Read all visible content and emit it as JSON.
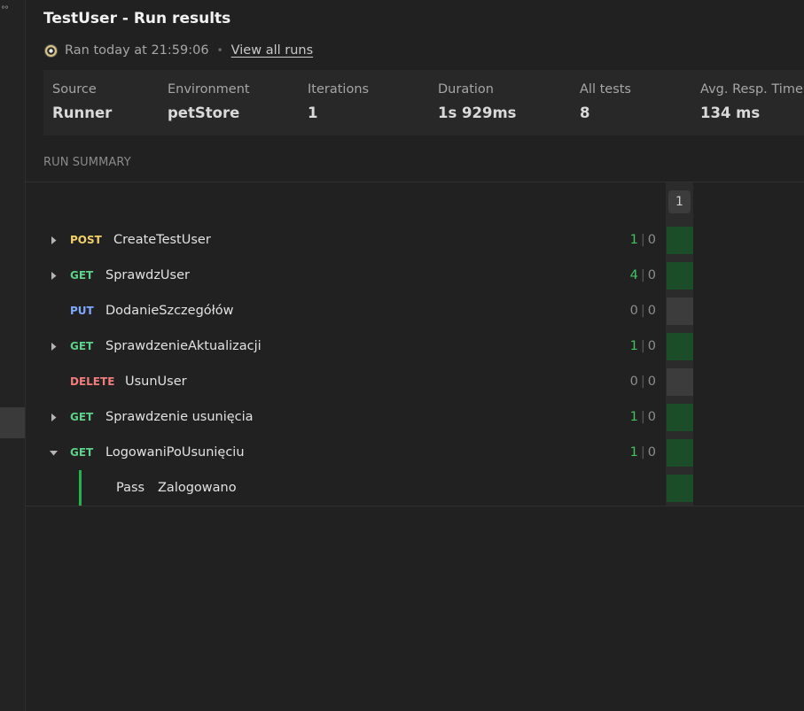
{
  "header": {
    "title": "TestUser - Run results",
    "ran_text": "Ran today at 21:59:06",
    "separator": "•",
    "view_all_runs": "View all runs"
  },
  "stats": [
    {
      "label": "Source",
      "value": "Runner"
    },
    {
      "label": "Environment",
      "value": "petStore"
    },
    {
      "label": "Iterations",
      "value": "1"
    },
    {
      "label": "Duration",
      "value": "1s 929ms"
    },
    {
      "label": "All tests",
      "value": "8"
    },
    {
      "label": "Avg. Resp. Time",
      "value": "134 ms"
    }
  ],
  "summary": {
    "section_label": "RUN SUMMARY",
    "iteration_label": "1",
    "count_separator": "|",
    "requests": [
      {
        "method": "POST",
        "name": "CreateTestUser",
        "passed": "1",
        "failed": "0",
        "expandable": true,
        "expanded": false,
        "status": "pass"
      },
      {
        "method": "GET",
        "name": "SprawdzUser",
        "passed": "4",
        "failed": "0",
        "expandable": true,
        "expanded": false,
        "status": "pass"
      },
      {
        "method": "PUT",
        "name": "DodanieSzczegółów",
        "passed": "0",
        "failed": "0",
        "expandable": false,
        "expanded": false,
        "status": "none"
      },
      {
        "method": "GET",
        "name": "SprawdzenieAktualizacji",
        "passed": "1",
        "failed": "0",
        "expandable": true,
        "expanded": false,
        "status": "pass"
      },
      {
        "method": "DELETE",
        "name": "UsunUser",
        "passed": "0",
        "failed": "0",
        "expandable": false,
        "expanded": false,
        "status": "none"
      },
      {
        "method": "GET",
        "name": "Sprawdzenie usunięcia",
        "passed": "1",
        "failed": "0",
        "expandable": true,
        "expanded": false,
        "status": "pass"
      },
      {
        "method": "GET",
        "name": "LogowaniPoUsunięciu",
        "passed": "1",
        "failed": "0",
        "expandable": true,
        "expanded": true,
        "status": "pass"
      }
    ],
    "test_result": {
      "status": "Pass",
      "name": "Zalogowano"
    }
  },
  "colors": {
    "POST": "#f3d069",
    "GET": "#5fd08a",
    "PUT": "#7fa8ff",
    "DELETE": "#f07d7d",
    "pass": "#43c463",
    "pass_cell": "#1c4d29",
    "none_cell": "#3c3c3c"
  },
  "icons": {
    "runner": "runner-gear-icon",
    "collapsed": "caret-right-icon",
    "expanded": "caret-down-icon",
    "more": "more-dots-icon"
  }
}
